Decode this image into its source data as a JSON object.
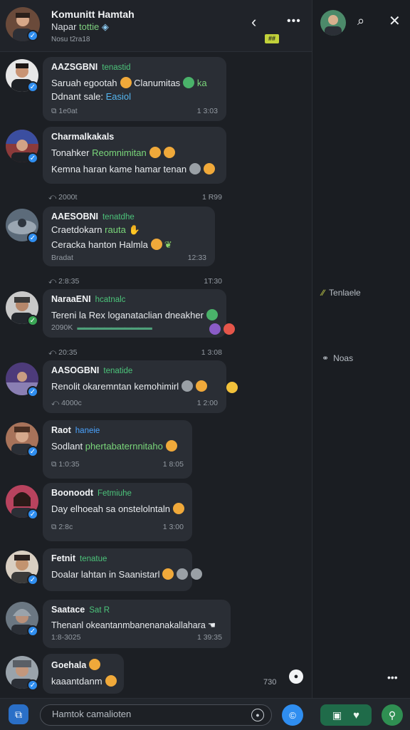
{
  "header": {
    "title": "Komunitt Hamtah",
    "subtitle_prefix": "Napar",
    "subtitle_accent": "tottie",
    "time": "Nosu t2ra18",
    "badge": "##"
  },
  "side": {
    "item1": "Tenlaele",
    "item2": "Noas"
  },
  "messages": [
    {
      "name": "AAZSGBNI",
      "tag": "tenastid",
      "line1_a": "Saruah egootah",
      "line1_b": "Clanumitas",
      "line1_c": "ka",
      "line2_a": "Ddnant sale:",
      "line2_b": "Easiol",
      "meta_left": "1e0at",
      "meta_right": "1 3:03"
    },
    {
      "name": "Charmalkakals",
      "line1_a": "Tonahker",
      "line1_b": "Reomnimitan",
      "line2": "Kemna haran kame hamar tenan",
      "meta_left": "2000t",
      "meta_right": "1 R99"
    },
    {
      "name": "AAESOBNI",
      "tag": "tenatdhe",
      "line1_a": "Craetdokarn",
      "line1_b": "rauta",
      "line2": "Ceracka hanton Halmla",
      "line3": "Bradat",
      "meta_time": "12:33",
      "meta_left": "2:8:35",
      "meta_right": "1T:30"
    },
    {
      "name": "NaraaENI",
      "tag": "hcatnalc",
      "line1": "Tereni la Rex loganataclian dneakher",
      "line2": "2090K",
      "meta_left": "20:35",
      "meta_right": "1 3:08"
    },
    {
      "name": "AASOGBNI",
      "tag": "tenatide",
      "line1": "Renolit okaremntan kemohimirl",
      "meta_left": "4000c",
      "meta_right": "1 2:00"
    },
    {
      "name": "Raot",
      "tag": "haneie",
      "line1_a": "Sodlant",
      "line1_b": "phertabaternnitaho",
      "meta_left": "1:0:35",
      "meta_right": "1 8:05"
    },
    {
      "name": "Boonoodt",
      "tag": "Fetmiuhe",
      "line1": "Day elhoeah sa onstelolntaln",
      "meta_left": "2:8c",
      "meta_right": "1 3:00"
    },
    {
      "name": "Fetnit",
      "tag": "tenatue",
      "line1": "Doalar lahtan in Saanistarl",
      "meta_right": ""
    },
    {
      "name": "Saatace",
      "tag": "Sat R",
      "line1": "Thenanl okeantanmbanenanakallahara",
      "meta_left": "1:8-3025",
      "meta_right": "1 39:35"
    },
    {
      "name": "Goehala",
      "line1": "kaaantdanm",
      "meta_right": "730"
    }
  ],
  "composer": {
    "placeholder": "Hamtok camalioten"
  },
  "colors": {
    "accent_green": "#4cc37a",
    "verified_blue": "#2f8ef0",
    "send_blue": "#2f8ef0"
  }
}
